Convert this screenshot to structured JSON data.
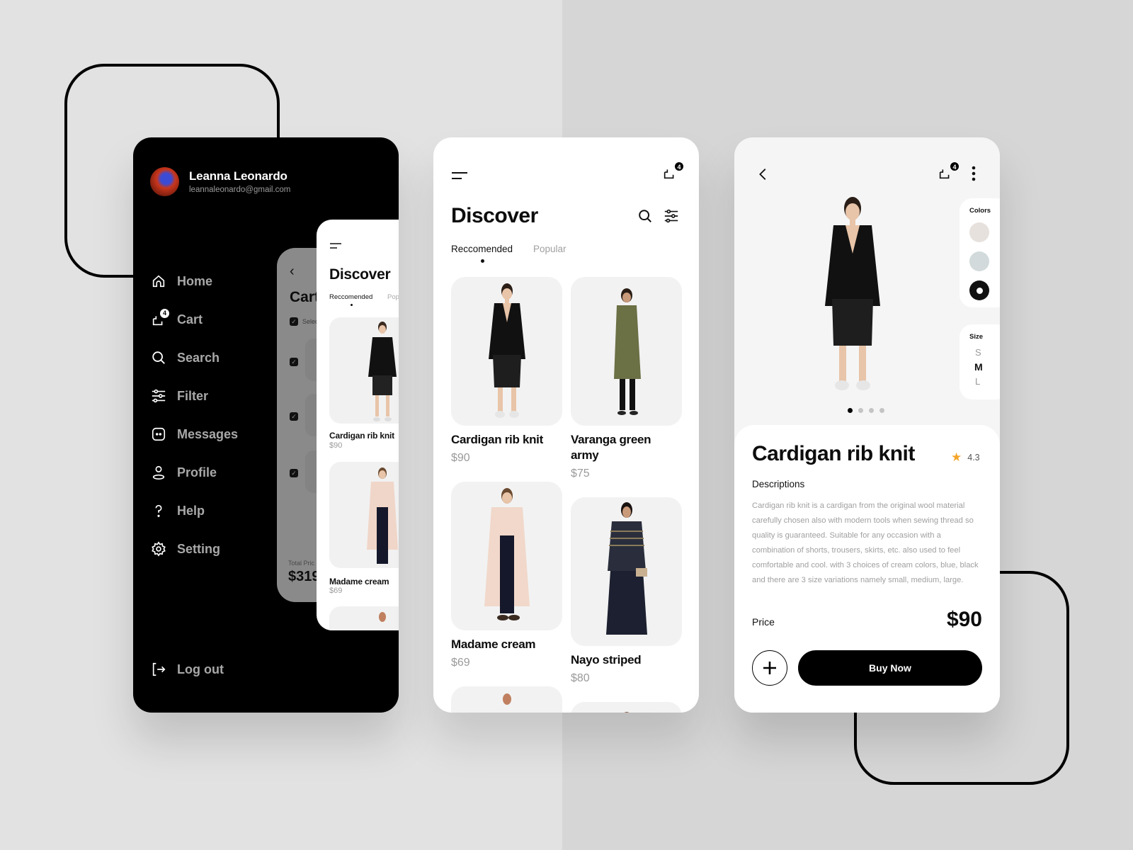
{
  "background": {
    "left_color": "#e2e2e2",
    "right_color": "#d6d6d6"
  },
  "menu_screen": {
    "user": {
      "name": "Leanna Leonardo",
      "email": "leannaleonardo@gmail.com"
    },
    "items": [
      {
        "icon": "home-icon",
        "label": "Home"
      },
      {
        "icon": "cart-icon",
        "label": "Cart",
        "badge": "4"
      },
      {
        "icon": "search-icon",
        "label": "Search"
      },
      {
        "icon": "filter-icon",
        "label": "Filter"
      },
      {
        "icon": "message-icon",
        "label": "Messages"
      },
      {
        "icon": "profile-icon",
        "label": "Profile"
      },
      {
        "icon": "help-icon",
        "label": "Help"
      },
      {
        "icon": "gear-icon",
        "label": "Setting"
      }
    ],
    "logout_label": "Log out",
    "cart_preview": {
      "title": "Cart",
      "select_label": "Selec",
      "total_label": "Total Pric",
      "total_value": "$319"
    },
    "discover_preview": {
      "title": "Discover",
      "tabs": [
        "Reccomended",
        "Pop"
      ],
      "products": [
        {
          "name": "Cardigan rib knit",
          "price": "$90"
        },
        {
          "name": "Madame cream",
          "price": "$69"
        }
      ]
    }
  },
  "discover_screen": {
    "cart_badge": "4",
    "title": "Discover",
    "tabs": [
      {
        "label": "Reccomended",
        "active": true
      },
      {
        "label": "Popular",
        "active": false
      }
    ],
    "products": [
      {
        "name": "Cardigan rib knit",
        "price": "$90"
      },
      {
        "name": "Varanga green army",
        "price": "$75"
      },
      {
        "name": "Madame cream",
        "price": "$69"
      },
      {
        "name": "Nayo striped",
        "price": "$80"
      }
    ]
  },
  "detail_screen": {
    "cart_badge": "4",
    "colors_label": "Colors",
    "colors": [
      {
        "name": "cream",
        "hex": "#e6e1dc",
        "selected": false
      },
      {
        "name": "blue",
        "hex": "#d2dadb",
        "selected": false
      },
      {
        "name": "black",
        "hex": "#111111",
        "selected": true
      }
    ],
    "size_label": "Size",
    "sizes": [
      {
        "label": "S",
        "selected": false
      },
      {
        "label": "M",
        "selected": true
      },
      {
        "label": "L",
        "selected": false
      }
    ],
    "image_pages": 4,
    "image_page_active": 1,
    "product_name": "Cardigan rib knit",
    "rating": "4.3",
    "description_heading": "Descriptions",
    "description": "Cardigan rib knit is a cardigan from the original wool material carefully chosen also with modern tools when sewing thread so quality is guaranteed. Suitable for any occasion with a combination of shorts, trousers, skirts, etc. also used to feel comfortable and cool. with 3 choices of cream colors, blue, black and there are 3 size variations namely small, medium, large.",
    "price_label": "Price",
    "price": "$90",
    "buy_label": "Buy Now",
    "accent": "#f4a52a"
  }
}
